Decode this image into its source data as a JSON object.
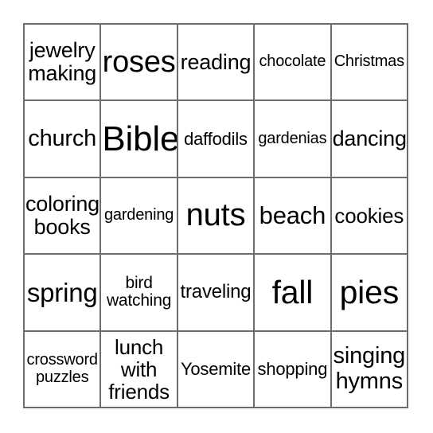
{
  "card": {
    "type": "bingo-card",
    "columns": 5,
    "rows": 5,
    "border_color": "#6d6d6d",
    "background_color": "#ffffff",
    "text_color": "#000000",
    "cells": [
      {
        "text": "jewelry\nmaking",
        "font_size": 27,
        "lines": 2
      },
      {
        "text": "roses",
        "font_size": 38,
        "lines": 1
      },
      {
        "text": "reading",
        "font_size": 27,
        "lines": 1
      },
      {
        "text": "chocolate",
        "font_size": 20,
        "lines": 1
      },
      {
        "text": "Christmas",
        "font_size": 20,
        "lines": 1
      },
      {
        "text": "church",
        "font_size": 29,
        "lines": 1
      },
      {
        "text": "Bible",
        "font_size": 44,
        "lines": 1
      },
      {
        "text": "daffodils",
        "font_size": 22,
        "lines": 1
      },
      {
        "text": "gardenias",
        "font_size": 20,
        "lines": 1
      },
      {
        "text": "dancing",
        "font_size": 27,
        "lines": 1
      },
      {
        "text": "coloring\nbooks",
        "font_size": 27,
        "lines": 2
      },
      {
        "text": "gardening",
        "font_size": 20,
        "lines": 1
      },
      {
        "text": "nuts",
        "font_size": 40,
        "lines": 1
      },
      {
        "text": "beach",
        "font_size": 31,
        "lines": 1
      },
      {
        "text": "cookies",
        "font_size": 26,
        "lines": 1
      },
      {
        "text": "spring",
        "font_size": 33,
        "lines": 1
      },
      {
        "text": "bird\nwatching",
        "font_size": 21,
        "lines": 2
      },
      {
        "text": "traveling",
        "font_size": 24,
        "lines": 1
      },
      {
        "text": "fall",
        "font_size": 41,
        "lines": 1
      },
      {
        "text": "pies",
        "font_size": 41,
        "lines": 1
      },
      {
        "text": "crossword\npuzzles",
        "font_size": 20,
        "lines": 2
      },
      {
        "text": "lunch\nwith\nfriends",
        "font_size": 26,
        "lines": 3
      },
      {
        "text": "Yosemite",
        "font_size": 22,
        "lines": 1
      },
      {
        "text": "shopping",
        "font_size": 22,
        "lines": 1
      },
      {
        "text": "singing\nhymns",
        "font_size": 29,
        "lines": 2
      }
    ]
  }
}
